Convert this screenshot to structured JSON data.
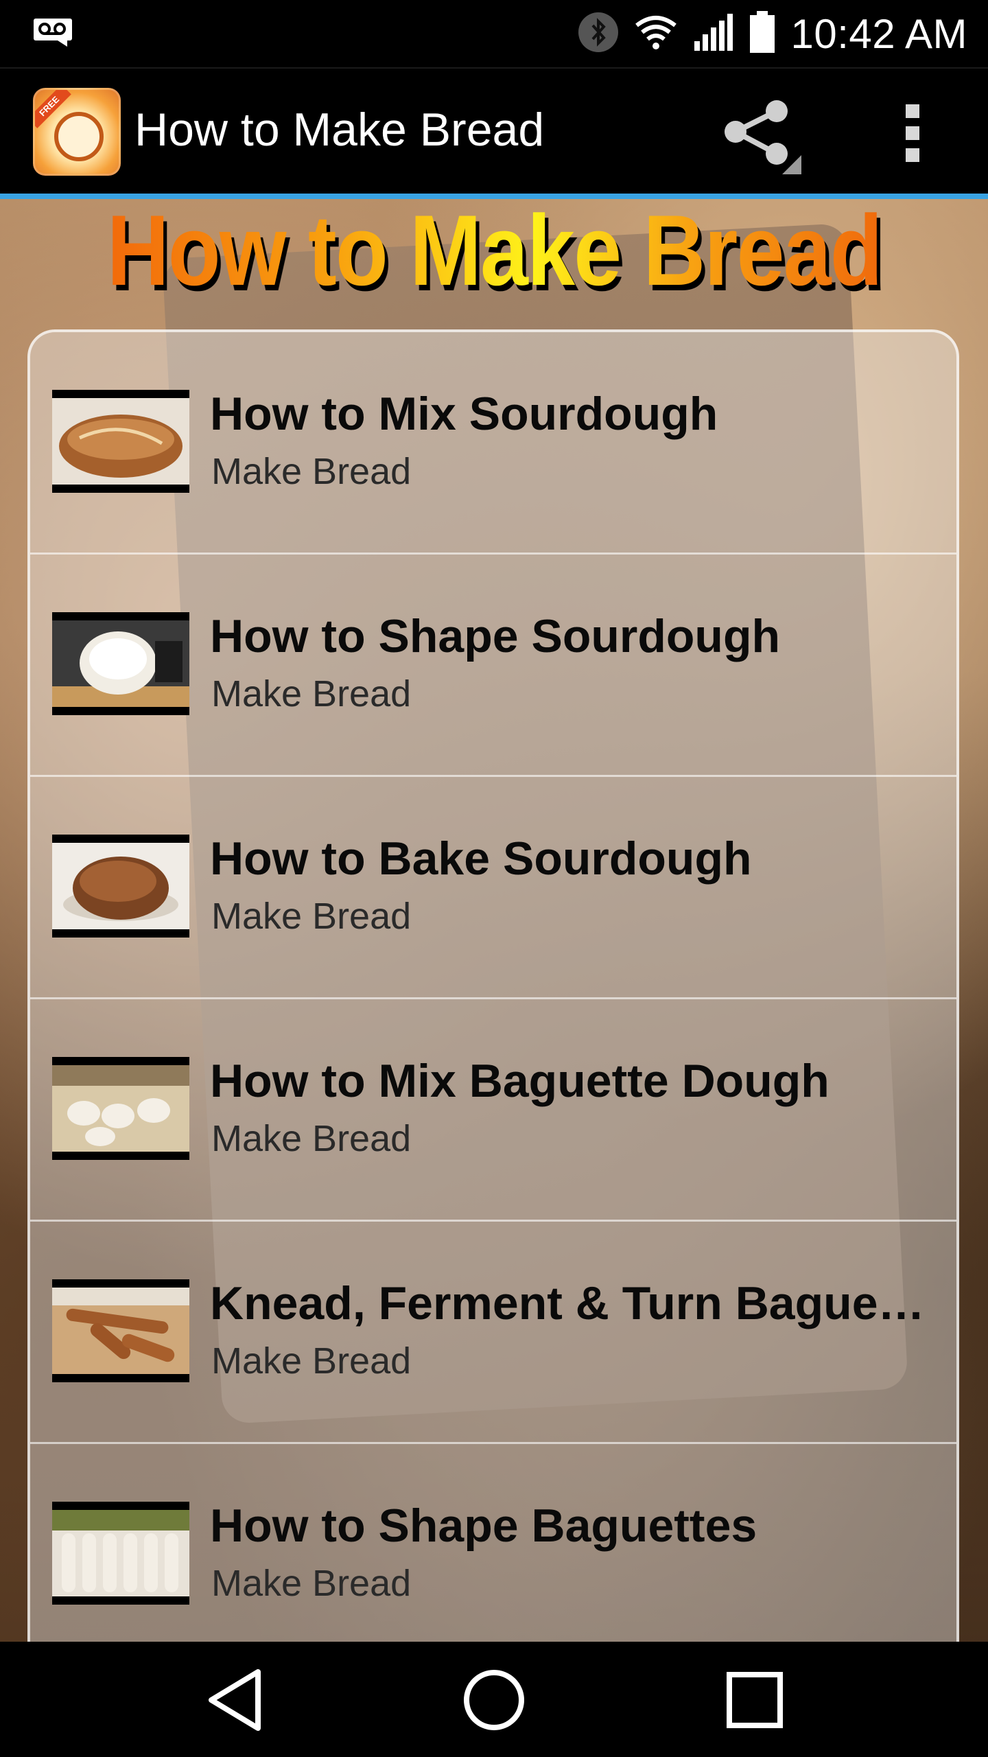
{
  "status_bar": {
    "time": "10:42 AM",
    "icons": [
      "voicemail-icon",
      "bluetooth-icon",
      "wifi-icon",
      "signal-icon",
      "battery-icon"
    ]
  },
  "action_bar": {
    "title": "How to Make Bread",
    "app_icon_badge": "FREE",
    "share_icon": "share-icon",
    "overflow_icon": "more-vert-icon"
  },
  "banner": {
    "text": "How to Make Bread"
  },
  "list": {
    "items": [
      {
        "title": "How to Mix Sourdough",
        "subtitle": "Make Bread",
        "thumb": "sourdough-loaf"
      },
      {
        "title": "How to Shape Sourdough",
        "subtitle": "Make Bread",
        "thumb": "dough-bowl"
      },
      {
        "title": "How to Bake Sourdough",
        "subtitle": "Make Bread",
        "thumb": "baked-loaf"
      },
      {
        "title": "How to Mix Baguette Dough",
        "subtitle": "Make Bread",
        "thumb": "dough-balls"
      },
      {
        "title": "Knead, Ferment & Turn Baguet…",
        "subtitle": "Make Bread",
        "thumb": "baguettes-board"
      },
      {
        "title": "How to Shape Baguettes",
        "subtitle": "Make Bread",
        "thumb": "baguettes-shaping"
      }
    ]
  },
  "nav_bar": {
    "buttons": [
      "back-icon",
      "home-icon",
      "recents-icon"
    ]
  },
  "colors": {
    "accent_line": "#3aa3e3",
    "banner_orange": "#f26a0b",
    "banner_yellow": "#fff21a"
  }
}
